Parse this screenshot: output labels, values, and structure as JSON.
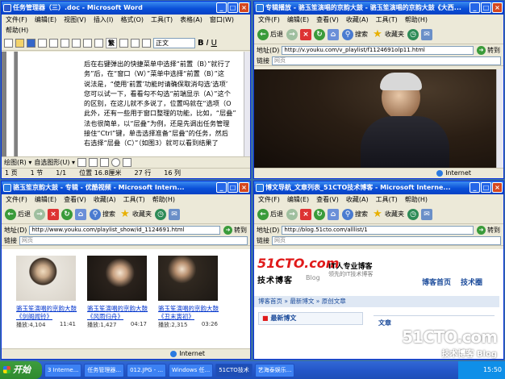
{
  "word": {
    "title": "任务管理器（三）.doc - Microsoft Word",
    "menu": [
      "文件(F)",
      "编辑(E)",
      "视图(V)",
      "插入(I)",
      "格式(O)",
      "工具(T)",
      "表格(A)",
      "窗口(W)"
    ],
    "menu2": [
      "帮助(H)"
    ],
    "font_label": "繁",
    "style_label": "正文",
    "doc_lines": [
      "后在右键弹出的快捷菜单中选择“前置（B）”就行了",
      "务”后，在“窗口（W）”菜单中选择“前置（B）”这",
      "说法是，“使用‘前置’功能时请确保取消勾选‘选项’",
      "您可以试一下，看看勾不勾选“前端显示（A）”这个",
      "的区别，在这儿就不多说了，位置吗就在“选项（O",
      "此外，还有一些用于窗口整理的功能，比如，“层叠”",
      "法也很简单，以“层叠”为例，还是先调出任务管理",
      "接住“Ctrl”键，单击选择准备“层叠”的任务，然后",
      "右选择“层叠（C）”（如图3）就可以看到结果了"
    ],
    "drawing_label": "绘图(R) ▾",
    "autoshape_label": "自选图形(U) ▾",
    "status": {
      "page": "1 页",
      "section": "1 节",
      "pos": "1/1",
      "at": "位置 16.8厘米",
      "line": "27 行",
      "col": "16 列"
    }
  },
  "video": {
    "title": "专辑播放 - 骆玉笙演唱的京韵大鼓 - 骆玉笙演唱的京韵大鼓《大西...",
    "menu": [
      "文件(F)",
      "编辑(E)",
      "查看(V)",
      "收藏(A)",
      "工具(T)",
      "帮助(H)"
    ],
    "back": "后退",
    "search": "搜索",
    "favorites": "收藏夹",
    "address_label": "地址(D)",
    "address": "http://v.youku.com/v_playlist/f1124691olp11.html",
    "go": "转到",
    "links_label": "链接",
    "links_box": "网页",
    "status": "Internet"
  },
  "youku": {
    "title": "骆玉笙京韵大鼓 - 专辑 - 优酷视频 - Microsoft Intern...",
    "menu": [
      "文件(F)",
      "编辑(E)",
      "查看(V)",
      "收藏(A)",
      "工具(T)",
      "帮助(H)"
    ],
    "back": "后退",
    "search": "搜索",
    "favorites": "收藏夹",
    "address_label": "地址(D)",
    "address": "http://www.youku.com/playlist_show/id_1124691.html",
    "go": "转到",
    "links_label": "链接",
    "links_box": "网页",
    "videos": [
      {
        "title": "骆玉笙演唱的京韵大鼓《剑阁闻铃》",
        "plays_label": "播放:",
        "plays": "4,104",
        "duration": "11:41"
      },
      {
        "title": "骆玉笙演唱的京韵大鼓《风雨归舟》",
        "plays_label": "播放:",
        "plays": "1,427",
        "duration": "04:17"
      },
      {
        "title": "骆玉笙演唱的京韵大鼓《丑末寅初》",
        "plays_label": "播放:",
        "plays": "2,315",
        "duration": "03:26"
      }
    ],
    "status": "Internet"
  },
  "blog": {
    "title": "博文导航_文章列表_51CTO技术博客 - Microsoft Interne...",
    "menu": [
      "文件(F)",
      "编辑(E)",
      "查看(V)",
      "收藏(A)",
      "工具(T)",
      "帮助(H)"
    ],
    "back": "后退",
    "search": "搜索",
    "favorites": "收藏夹",
    "address_label": "地址(D)",
    "address": "http://blog.51cto.com/alllist/1",
    "go": "转到",
    "links_label": "链接",
    "links_box": "网页",
    "logo": "51CTO.com",
    "logo_sub": "技术博客",
    "logo_blog": "Blog",
    "slogan1": "IT人专业博客",
    "slogan2": "领先的IT技术博客",
    "nav": [
      "博客首页",
      "技术圈"
    ],
    "breadcrumb": [
      "博客首页",
      "最新博文",
      "原创文章"
    ],
    "section": "最新博文",
    "side": "文章"
  },
  "taskbar": {
    "start": "开始",
    "buttons": [
      "3 Interne...",
      "任务管理器...",
      "012.JPG - ...",
      "Windows 任...",
      "51CTO技术",
      "艺海泰娱乐..."
    ],
    "clock": "15:50"
  },
  "watermark": {
    "line1": "51CTO.com",
    "line2": "技术博客 Blog"
  },
  "colors": {
    "titlebar": "#0a4fd8",
    "xp_face": "#ece9d8",
    "taskbar": "#245edb",
    "start": "#3d9d3d",
    "logo_red": "#e01a1a"
  }
}
